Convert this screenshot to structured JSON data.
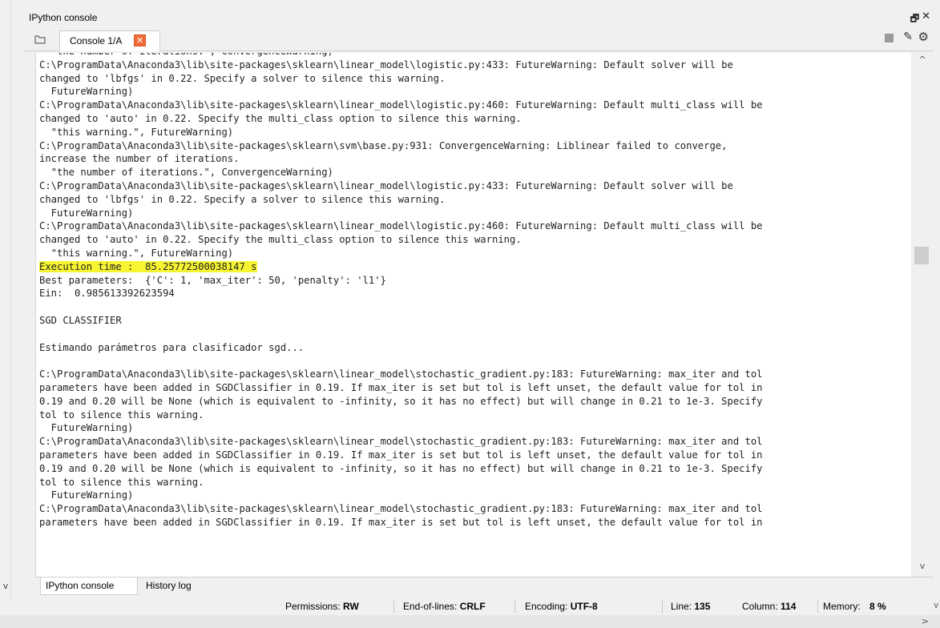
{
  "pane": {
    "title": "IPython console",
    "undock_glyph": "🗗",
    "close_glyph": "✕"
  },
  "tabs": {
    "console_tab_label": "Console 1/A",
    "close_tab_glyph": "✕"
  },
  "toolbar": {
    "clear_glyph": "✎",
    "options_glyph": "⚙"
  },
  "console": {
    "lines": [
      {
        "text": "  \"the number of iterations.\", ConvergenceWarning)",
        "highlight": false
      },
      {
        "text": "C:\\ProgramData\\Anaconda3\\lib\\site-packages\\sklearn\\linear_model\\logistic.py:433: FutureWarning: Default solver will be",
        "highlight": false
      },
      {
        "text": "changed to 'lbfgs' in 0.22. Specify a solver to silence this warning.",
        "highlight": false
      },
      {
        "text": "  FutureWarning)",
        "highlight": false
      },
      {
        "text": "C:\\ProgramData\\Anaconda3\\lib\\site-packages\\sklearn\\linear_model\\logistic.py:460: FutureWarning: Default multi_class will be",
        "highlight": false
      },
      {
        "text": "changed to 'auto' in 0.22. Specify the multi_class option to silence this warning.",
        "highlight": false
      },
      {
        "text": "  \"this warning.\", FutureWarning)",
        "highlight": false
      },
      {
        "text": "C:\\ProgramData\\Anaconda3\\lib\\site-packages\\sklearn\\svm\\base.py:931: ConvergenceWarning: Liblinear failed to converge,",
        "highlight": false
      },
      {
        "text": "increase the number of iterations.",
        "highlight": false
      },
      {
        "text": "  \"the number of iterations.\", ConvergenceWarning)",
        "highlight": false
      },
      {
        "text": "C:\\ProgramData\\Anaconda3\\lib\\site-packages\\sklearn\\linear_model\\logistic.py:433: FutureWarning: Default solver will be",
        "highlight": false
      },
      {
        "text": "changed to 'lbfgs' in 0.22. Specify a solver to silence this warning.",
        "highlight": false
      },
      {
        "text": "  FutureWarning)",
        "highlight": false
      },
      {
        "text": "C:\\ProgramData\\Anaconda3\\lib\\site-packages\\sklearn\\linear_model\\logistic.py:460: FutureWarning: Default multi_class will be",
        "highlight": false
      },
      {
        "text": "changed to 'auto' in 0.22. Specify the multi_class option to silence this warning.",
        "highlight": false
      },
      {
        "text": "  \"this warning.\", FutureWarning)",
        "highlight": false
      },
      {
        "text": "Execution time :  85.25772500038147 s",
        "highlight": true
      },
      {
        "text": "Best parameters:  {'C': 1, 'max_iter': 50, 'penalty': 'l1'}",
        "highlight": false
      },
      {
        "text": "Ein:  0.985613392623594",
        "highlight": false
      },
      {
        "text": "",
        "highlight": false
      },
      {
        "text": "SGD CLASSIFIER",
        "highlight": false
      },
      {
        "text": "",
        "highlight": false
      },
      {
        "text": "Estimando parámetros para clasificador sgd...",
        "highlight": false
      },
      {
        "text": "",
        "highlight": false
      },
      {
        "text": "C:\\ProgramData\\Anaconda3\\lib\\site-packages\\sklearn\\linear_model\\stochastic_gradient.py:183: FutureWarning: max_iter and tol",
        "highlight": false
      },
      {
        "text": "parameters have been added in SGDClassifier in 0.19. If max_iter is set but tol is left unset, the default value for tol in",
        "highlight": false
      },
      {
        "text": "0.19 and 0.20 will be None (which is equivalent to -infinity, so it has no effect) but will change in 0.21 to 1e-3. Specify",
        "highlight": false
      },
      {
        "text": "tol to silence this warning.",
        "highlight": false
      },
      {
        "text": "  FutureWarning)",
        "highlight": false
      },
      {
        "text": "C:\\ProgramData\\Anaconda3\\lib\\site-packages\\sklearn\\linear_model\\stochastic_gradient.py:183: FutureWarning: max_iter and tol",
        "highlight": false
      },
      {
        "text": "parameters have been added in SGDClassifier in 0.19. If max_iter is set but tol is left unset, the default value for tol in",
        "highlight": false
      },
      {
        "text": "0.19 and 0.20 will be None (which is equivalent to -infinity, so it has no effect) but will change in 0.21 to 1e-3. Specify",
        "highlight": false
      },
      {
        "text": "tol to silence this warning.",
        "highlight": false
      },
      {
        "text": "  FutureWarning)",
        "highlight": false
      },
      {
        "text": "C:\\ProgramData\\Anaconda3\\lib\\site-packages\\sklearn\\linear_model\\stochastic_gradient.py:183: FutureWarning: max_iter and tol",
        "highlight": false
      },
      {
        "text": "parameters have been added in SGDClassifier in 0.19. If max_iter is set but tol is left unset, the default value for tol in",
        "highlight": false
      }
    ],
    "highlight_color": "#f7f531"
  },
  "bottom_tabs": {
    "console_label": "IPython console",
    "history_label": "History log"
  },
  "status": {
    "permissions_label": "Permissions:",
    "permissions_value": "RW",
    "eol_label": "End-of-lines:",
    "eol_value": "CRLF",
    "encoding_label": "Encoding:",
    "encoding_value": "UTF-8",
    "line_label": "Line:",
    "line_value": "135",
    "column_label": "Column:",
    "column_value": "114",
    "memory_label": "Memory:",
    "memory_value": "8 %"
  },
  "glyphs": {
    "up_chevron": "^",
    "down_chevron": "v",
    "left_chevron": "v",
    "right_chevron": ">"
  }
}
